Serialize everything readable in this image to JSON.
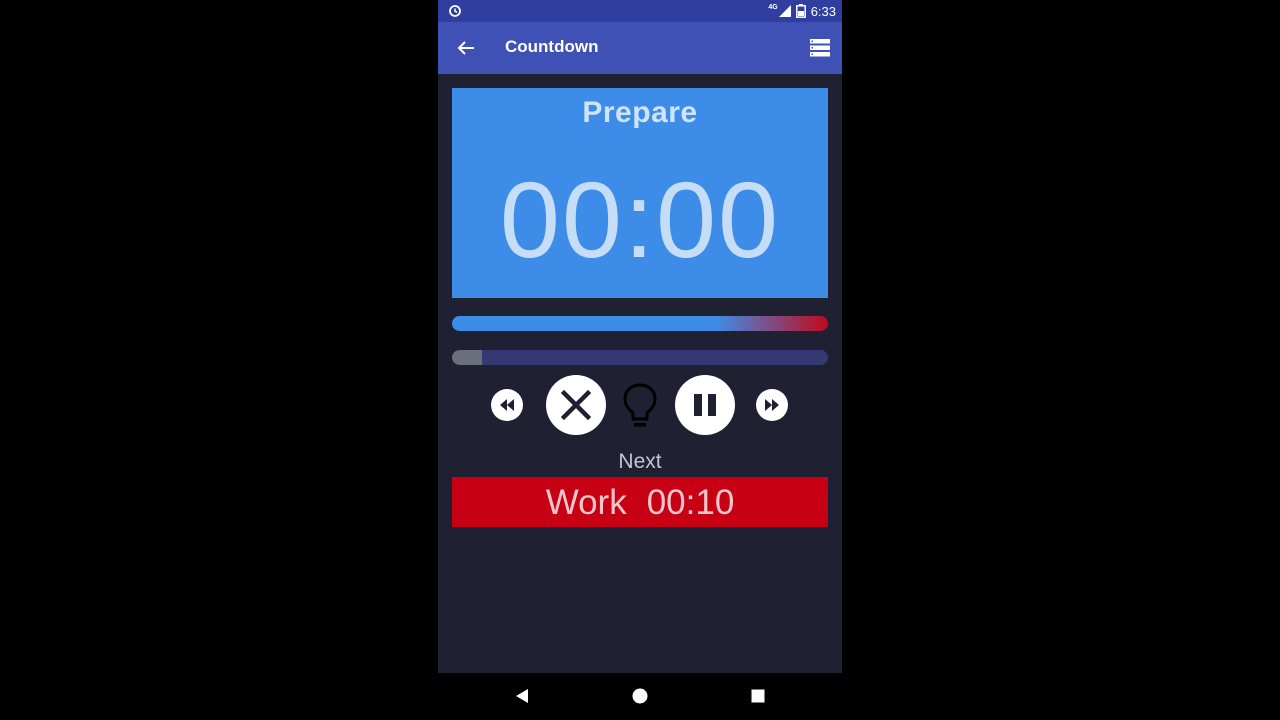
{
  "status_bar": {
    "network": "4G",
    "time": "6:33",
    "icons": [
      "sync-icon",
      "signal-icon",
      "battery-icon"
    ]
  },
  "app_bar": {
    "title": "Countdown",
    "icons": {
      "back": "arrow-back-icon",
      "menu": "list-menu-icon"
    }
  },
  "timer": {
    "phase": "Prepare",
    "time": "00:00",
    "color": "#3d8de8"
  },
  "progress": {
    "total_gradient": [
      "#3d8de8",
      "#c00a1c"
    ],
    "phase_fraction": 0.08
  },
  "controls": {
    "icons": [
      "rewind-icon",
      "close-icon",
      "lightbulb-icon",
      "pause-icon",
      "fast-forward-icon"
    ]
  },
  "next": {
    "label": "Next",
    "name": "Work",
    "time": "00:10",
    "color": "#c80014"
  },
  "nav_bar": {
    "icons": [
      "back-triangle-icon",
      "home-circle-icon",
      "recents-square-icon"
    ]
  }
}
